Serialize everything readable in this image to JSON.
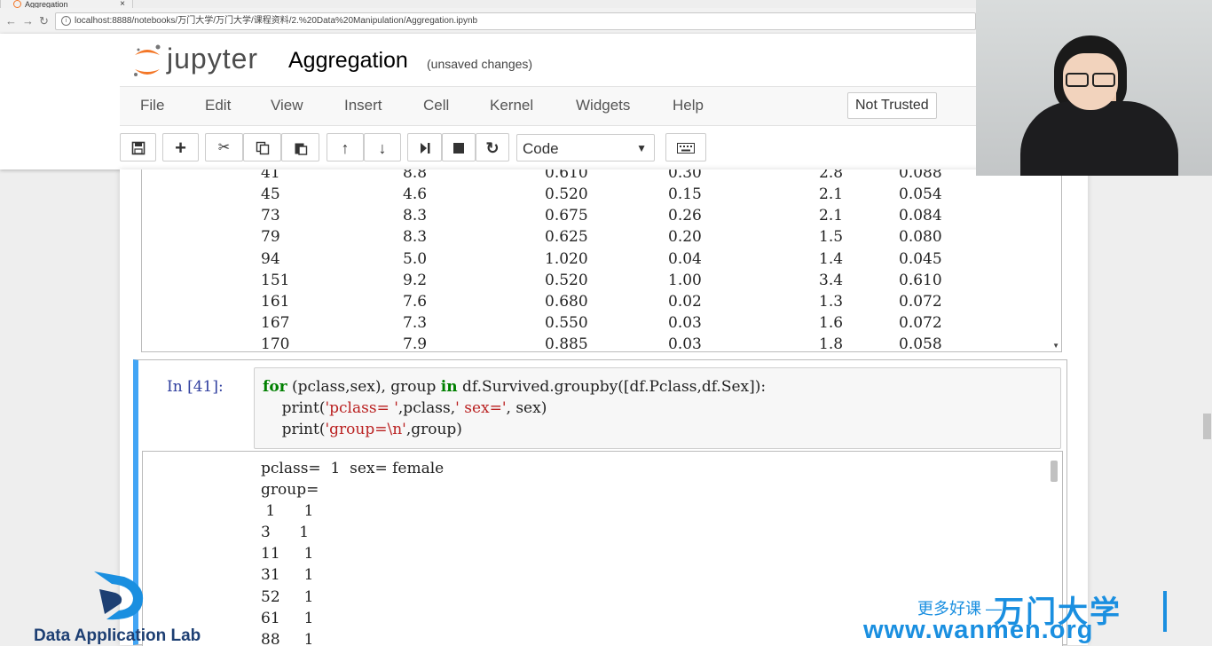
{
  "browser": {
    "tab_title": "Aggregation",
    "close_glyph": "×",
    "url": "localhost:8888/notebooks/万门大学/万门大学/课程资料/2.%20Data%20Manipulation/Aggregation.ipynb"
  },
  "header": {
    "logo_text": "jupyter",
    "notebook_title": "Aggregation",
    "status": "(unsaved changes)"
  },
  "menu": {
    "items": [
      "File",
      "Edit",
      "View",
      "Insert",
      "Cell",
      "Kernel",
      "Widgets",
      "Help"
    ],
    "trust_label": "Not Trusted"
  },
  "toolbar": {
    "buttons": [
      "save-icon",
      "add-icon",
      "cut-icon",
      "copy-icon",
      "paste-icon",
      "move-up-icon",
      "move-down-icon",
      "run-icon",
      "stop-icon",
      "restart-icon",
      "keyboard-icon"
    ],
    "cell_type": "Code"
  },
  "output_table": {
    "rows": [
      [
        "41",
        "8.8",
        "0.610",
        "0.30",
        "2.8",
        "0.088"
      ],
      [
        "45",
        "4.6",
        "0.520",
        "0.15",
        "2.1",
        "0.054"
      ],
      [
        "73",
        "8.3",
        "0.675",
        "0.26",
        "2.1",
        "0.084"
      ],
      [
        "79",
        "8.3",
        "0.625",
        "0.20",
        "1.5",
        "0.080"
      ],
      [
        "94",
        "5.0",
        "1.020",
        "0.04",
        "1.4",
        "0.045"
      ],
      [
        "151",
        "9.2",
        "0.520",
        "1.00",
        "3.4",
        "0.610"
      ],
      [
        "161",
        "7.6",
        "0.680",
        "0.02",
        "1.3",
        "0.072"
      ],
      [
        "167",
        "7.3",
        "0.550",
        "0.03",
        "1.6",
        "0.072"
      ],
      [
        "170",
        "7.9",
        "0.885",
        "0.03",
        "1.8",
        "0.058"
      ]
    ]
  },
  "cell": {
    "prompt": "In  [41]:",
    "code": {
      "line1_kw1": "for",
      "line1_a": " (pclass,sex), group ",
      "line1_kw2": "in",
      "line1_b": " df.Survived.groupby([df.Pclass,df.Sex]):",
      "line2_a": "    print(",
      "line2_s1": "'pclass= '",
      "line2_b": ",pclass,",
      "line2_s2": "' sex='",
      "line2_c": ", sex)",
      "line3_a": "    print(",
      "line3_s1": "'group=\\n'",
      "line3_b": ",group)"
    },
    "output_lines": [
      "pclass=  1  sex= female",
      "group=",
      " 1      1",
      "3      1",
      "11     1",
      "31     1",
      "52     1",
      "61     1",
      "88     1"
    ]
  },
  "watermarks": {
    "left_text": "Data Application Lab",
    "right_slogan": "更多好课 —",
    "right_brand": "万门大学",
    "right_url": "www.wanmen.org"
  }
}
